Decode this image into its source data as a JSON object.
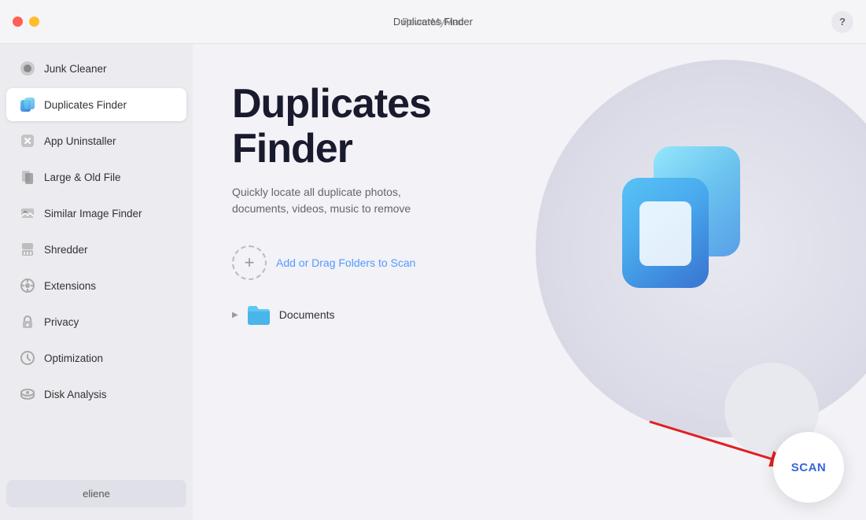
{
  "titlebar": {
    "app_name": "PowerMyMac",
    "window_title": "Duplicates Finder",
    "help_label": "?"
  },
  "sidebar": {
    "items": [
      {
        "id": "junk-cleaner",
        "label": "Junk Cleaner",
        "icon": "junk"
      },
      {
        "id": "duplicates-finder",
        "label": "Duplicates Finder",
        "icon": "duplicate",
        "active": true
      },
      {
        "id": "app-uninstaller",
        "label": "App Uninstaller",
        "icon": "uninstall"
      },
      {
        "id": "large-old-file",
        "label": "Large & Old File",
        "icon": "file"
      },
      {
        "id": "similar-image-finder",
        "label": "Similar Image Finder",
        "icon": "image"
      },
      {
        "id": "shredder",
        "label": "Shredder",
        "icon": "shredder"
      },
      {
        "id": "extensions",
        "label": "Extensions",
        "icon": "extensions"
      },
      {
        "id": "privacy",
        "label": "Privacy",
        "icon": "privacy"
      },
      {
        "id": "optimization",
        "label": "Optimization",
        "icon": "optimization"
      },
      {
        "id": "disk-analysis",
        "label": "Disk Analysis",
        "icon": "disk"
      }
    ],
    "user_label": "eliene"
  },
  "content": {
    "title_line1": "Duplicates",
    "title_line2": "Finder",
    "subtitle_line1": "Quickly locate all duplicate photos,",
    "subtitle_line2": "documents, videos, music to remove",
    "add_folder_label": "Add or Drag Folders to Scan",
    "folder_name": "Documents",
    "scan_label": "SCAN"
  }
}
